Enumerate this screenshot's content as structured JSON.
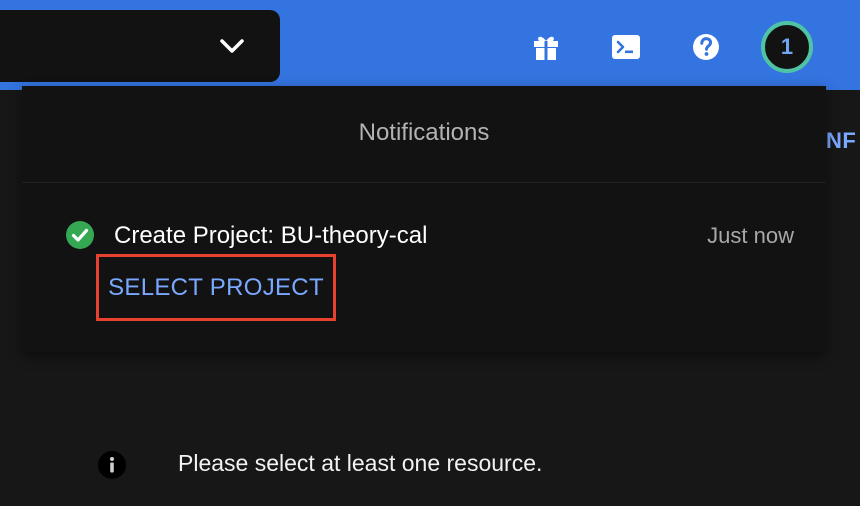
{
  "header": {
    "icons": {
      "picker": "chevron-down-icon",
      "gift": "gift-icon",
      "terminal": "terminal-icon",
      "help": "help-icon"
    },
    "avatar_label": "1",
    "colors": {
      "bar": "#3474e0",
      "avatar_ring": "#4fc4a4"
    }
  },
  "background": {
    "partial_text": "NF",
    "info_message": "Please select at least one resource."
  },
  "notifications": {
    "title": "Notifications",
    "items": [
      {
        "status_icon": "check-circle-icon",
        "text": "Create Project: BU-theory-cal",
        "time": "Just now",
        "action_label": "SELECT PROJECT"
      }
    ]
  },
  "accent": {
    "link": "#7aa7ff",
    "highlight": "#e8412f",
    "success": "#34a853"
  }
}
